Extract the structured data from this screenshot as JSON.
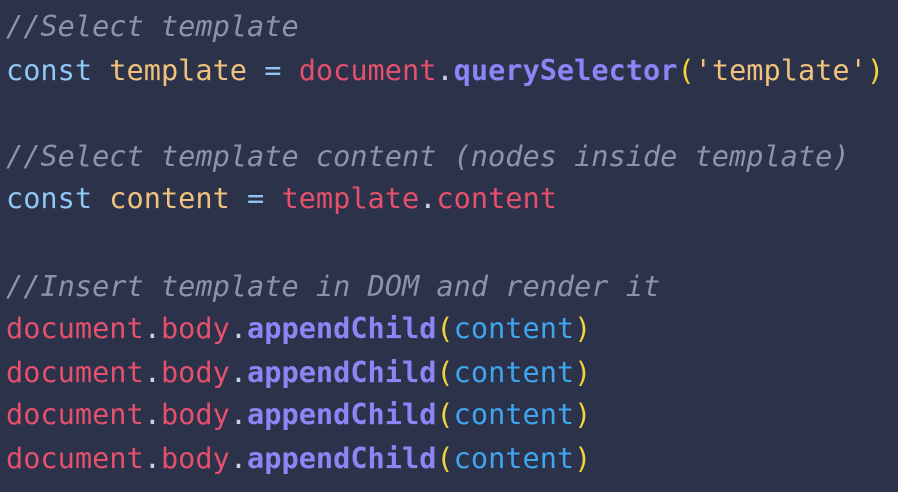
{
  "code": {
    "lines": [
      {
        "tokens": [
          {
            "t": "//Select template",
            "c": "comment"
          }
        ]
      },
      {
        "tokens": [
          {
            "t": "const",
            "c": "keyword"
          },
          {
            "t": " ",
            "c": "punct"
          },
          {
            "t": "template",
            "c": "ident-decl"
          },
          {
            "t": " ",
            "c": "punct"
          },
          {
            "t": "=",
            "c": "op"
          },
          {
            "t": " ",
            "c": "punct"
          },
          {
            "t": "document",
            "c": "ident-ref"
          },
          {
            "t": ".",
            "c": "punct"
          },
          {
            "t": "querySelector",
            "c": "method"
          },
          {
            "t": "(",
            "c": "paren"
          },
          {
            "t": "'template'",
            "c": "string"
          },
          {
            "t": ")",
            "c": "paren"
          }
        ]
      },
      {
        "tokens": []
      },
      {
        "tokens": [
          {
            "t": "//Select template content (nodes inside template)",
            "c": "comment"
          }
        ]
      },
      {
        "tokens": [
          {
            "t": "const",
            "c": "keyword"
          },
          {
            "t": " ",
            "c": "punct"
          },
          {
            "t": "content",
            "c": "ident-decl"
          },
          {
            "t": " ",
            "c": "punct"
          },
          {
            "t": "=",
            "c": "op"
          },
          {
            "t": " ",
            "c": "punct"
          },
          {
            "t": "template",
            "c": "ident-ref"
          },
          {
            "t": ".",
            "c": "punct"
          },
          {
            "t": "content",
            "c": "ident-ref"
          }
        ]
      },
      {
        "tokens": []
      },
      {
        "tokens": [
          {
            "t": "//Insert template in DOM and render it",
            "c": "comment"
          }
        ]
      },
      {
        "tokens": [
          {
            "t": "document",
            "c": "ident-ref"
          },
          {
            "t": ".",
            "c": "punct"
          },
          {
            "t": "body",
            "c": "ident-ref"
          },
          {
            "t": ".",
            "c": "punct"
          },
          {
            "t": "appendChild",
            "c": "method"
          },
          {
            "t": "(",
            "c": "paren"
          },
          {
            "t": "content",
            "c": "arg"
          },
          {
            "t": ")",
            "c": "paren"
          }
        ]
      },
      {
        "tokens": [
          {
            "t": "document",
            "c": "ident-ref"
          },
          {
            "t": ".",
            "c": "punct"
          },
          {
            "t": "body",
            "c": "ident-ref"
          },
          {
            "t": ".",
            "c": "punct"
          },
          {
            "t": "appendChild",
            "c": "method"
          },
          {
            "t": "(",
            "c": "paren"
          },
          {
            "t": "content",
            "c": "arg"
          },
          {
            "t": ")",
            "c": "paren"
          }
        ]
      },
      {
        "tokens": [
          {
            "t": "document",
            "c": "ident-ref"
          },
          {
            "t": ".",
            "c": "punct"
          },
          {
            "t": "body",
            "c": "ident-ref"
          },
          {
            "t": ".",
            "c": "punct"
          },
          {
            "t": "appendChild",
            "c": "method"
          },
          {
            "t": "(",
            "c": "paren"
          },
          {
            "t": "content",
            "c": "arg"
          },
          {
            "t": ")",
            "c": "paren"
          }
        ]
      },
      {
        "tokens": [
          {
            "t": "document",
            "c": "ident-ref"
          },
          {
            "t": ".",
            "c": "punct"
          },
          {
            "t": "body",
            "c": "ident-ref"
          },
          {
            "t": ".",
            "c": "punct"
          },
          {
            "t": "appendChild",
            "c": "method"
          },
          {
            "t": "(",
            "c": "paren"
          },
          {
            "t": "content",
            "c": "arg"
          },
          {
            "t": ")",
            "c": "paren"
          }
        ]
      }
    ]
  },
  "theme": {
    "background": "#2b3249",
    "comment": "#8b93ad",
    "keyword": "#8fc7f2",
    "declared_identifier": "#f1c27d",
    "referenced_identifier": "#e5506d",
    "method": "#8b86f5",
    "paren": "#f3d33b",
    "string": "#f1c27d",
    "argument": "#3fa5ee"
  }
}
